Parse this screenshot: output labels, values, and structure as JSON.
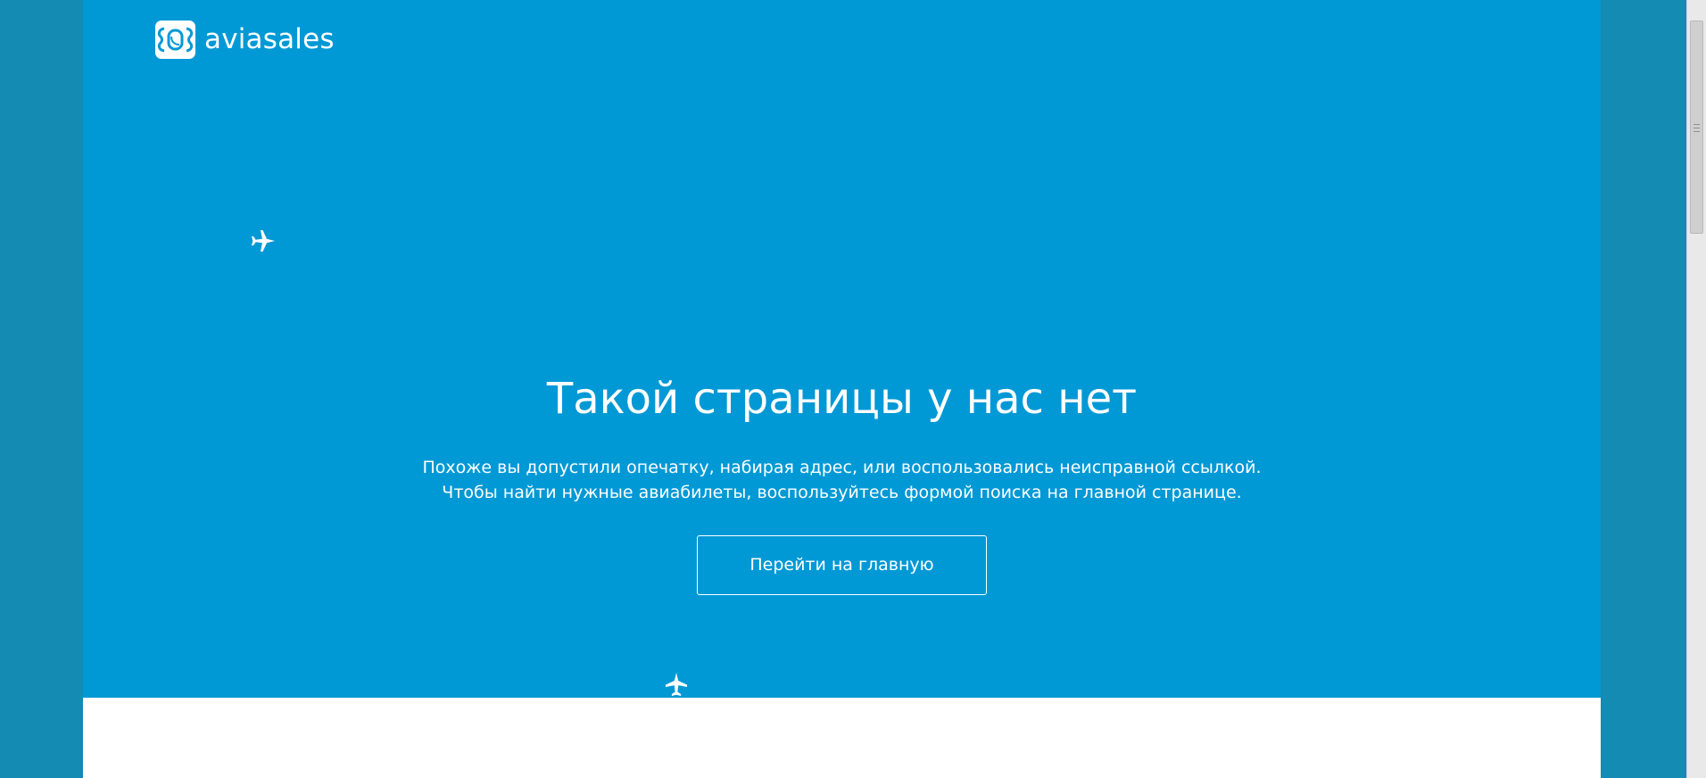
{
  "brand": {
    "name": "aviasales"
  },
  "notFound": {
    "title": "Такой страницы у нас нет",
    "line1": "Похоже вы допустили опечатку, набирая адрес, или воспользовались неисправной ссылкой.",
    "line2": "Чтобы найти нужные авиабилеты, воспользуйтесь формой поиска на главной странице.",
    "button": "Перейти на главную"
  },
  "icons": {
    "logo": "aviasales-logo-icon",
    "plane": "airplane-icon",
    "scrollbarGrip": "scrollbar-grip-icon"
  },
  "colors": {
    "outerBackground": "#138bb3",
    "heroBackground": "#0099d6",
    "foreground": "#ffffff",
    "pageBackground": "#ffffff"
  }
}
